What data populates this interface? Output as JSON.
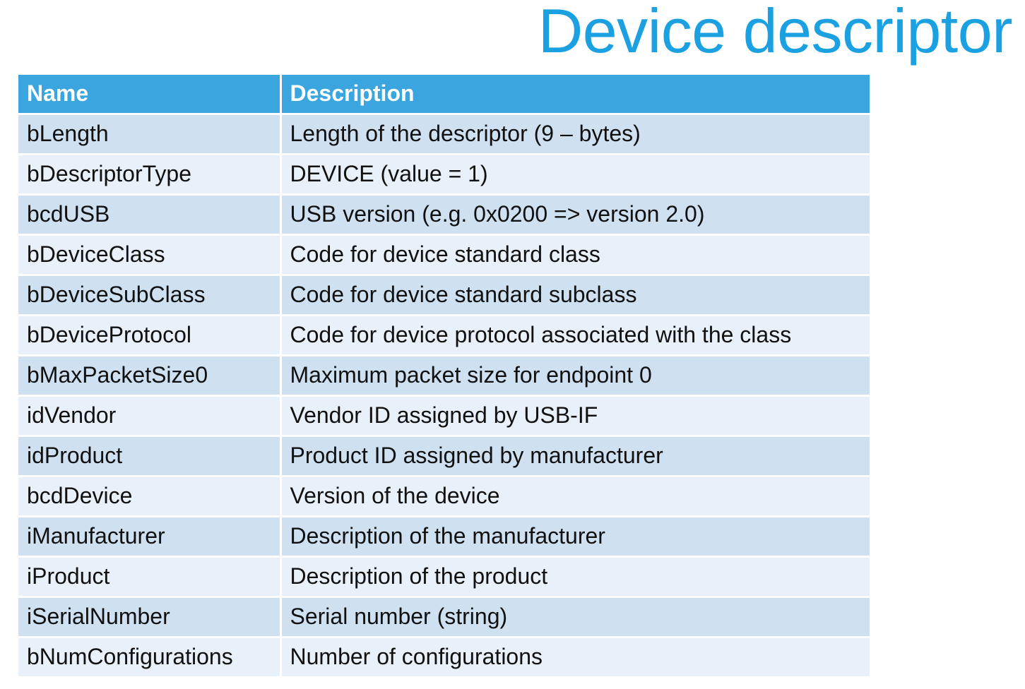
{
  "slide": {
    "title": "Device descriptor"
  },
  "table": {
    "headers": {
      "name": "Name",
      "description": "Description"
    },
    "rows": [
      {
        "name": "bLength",
        "description": "Length of the descriptor (9 – bytes)"
      },
      {
        "name": "bDescriptorType",
        "description": "DEVICE (value = 1)"
      },
      {
        "name": "bcdUSB",
        "description": "USB version (e.g. 0x0200 => version 2.0)"
      },
      {
        "name": "bDeviceClass",
        "description": "Code for device standard class"
      },
      {
        "name": "bDeviceSubClass",
        "description": "Code for device standard subclass"
      },
      {
        "name": "bDeviceProtocol",
        "description": "Code for device protocol associated with the class"
      },
      {
        "name": "bMaxPacketSize0",
        "description": "Maximum packet size for endpoint 0"
      },
      {
        "name": "idVendor",
        "description": "Vendor ID assigned by USB-IF"
      },
      {
        "name": "idProduct",
        "description": "Product ID assigned by manufacturer"
      },
      {
        "name": "bcdDevice",
        "description": "Version of the device"
      },
      {
        "name": "iManufacturer",
        "description": "Description of the manufacturer"
      },
      {
        "name": "iProduct",
        "description": "Description of the product"
      },
      {
        "name": "iSerialNumber",
        "description": "Serial number (string)"
      },
      {
        "name": "bNumConfigurations",
        "description": "Number of configurations"
      }
    ]
  },
  "colors": {
    "title": "#1ba1e2",
    "header_bg": "#3aa5df",
    "row_dark": "#cfe0f1",
    "row_light": "#e8f0f9"
  }
}
